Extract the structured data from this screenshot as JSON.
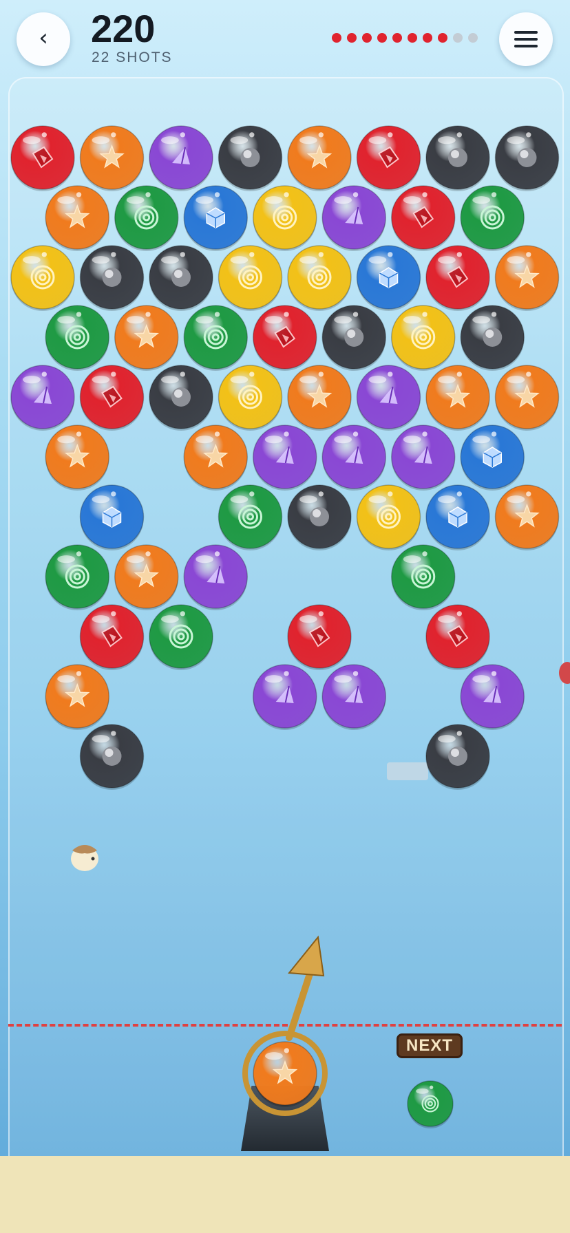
{
  "header": {
    "back_icon": "chevron-left-icon",
    "back_glyph": "‹",
    "menu_icon": "hamburger-menu-icon",
    "score": "220",
    "shots_label": "22 SHOTS",
    "progress_dots": {
      "total": 10,
      "filled": 8
    }
  },
  "next_label": "NEXT",
  "colors": {
    "red": "#e0232e",
    "orange": "#f07b1e",
    "purple": "#8a48d4",
    "black": "#3a3d44",
    "green": "#1f9a44",
    "blue": "#2a78d6",
    "yellow": "#f2c118",
    "danger_line": "#e04141"
  },
  "bubble_types": {
    "red": "diamond-gem-icon",
    "orange": "starfish-icon",
    "purple": "pyramid-icon",
    "black": "bomb-orb-icon",
    "green": "spiral-icon",
    "blue": "cube-icon",
    "yellow": "spiral-icon"
  },
  "grid": [
    [
      "red",
      "orange",
      "purple",
      "black",
      "orange",
      "red",
      "black",
      "black"
    ],
    [
      "orange",
      "green",
      "blue",
      "yellow",
      "purple",
      "red",
      "green"
    ],
    [
      "yellow",
      "black",
      "black",
      "yellow",
      "yellow",
      "blue",
      "red",
      "orange"
    ],
    [
      "green",
      "orange",
      "green",
      "red",
      "black",
      "yellow",
      "black"
    ],
    [
      "purple",
      "red",
      "black",
      "yellow",
      "orange",
      "purple",
      "orange",
      "orange"
    ],
    [
      "orange",
      null,
      "orange",
      "purple",
      "purple",
      "purple",
      "blue"
    ],
    [
      null,
      "blue",
      null,
      "green",
      "black",
      "yellow",
      "blue",
      "orange"
    ],
    [
      "green",
      "orange",
      "purple",
      null,
      null,
      "green",
      null
    ],
    [
      null,
      "red",
      "green",
      null,
      "red",
      null,
      "red",
      null
    ],
    [
      "orange",
      null,
      null,
      "purple",
      "purple",
      null,
      "purple"
    ],
    [
      null,
      "black",
      null,
      null,
      null,
      null,
      "black",
      null
    ]
  ],
  "current_bubble": "orange",
  "next_bubble": "green"
}
